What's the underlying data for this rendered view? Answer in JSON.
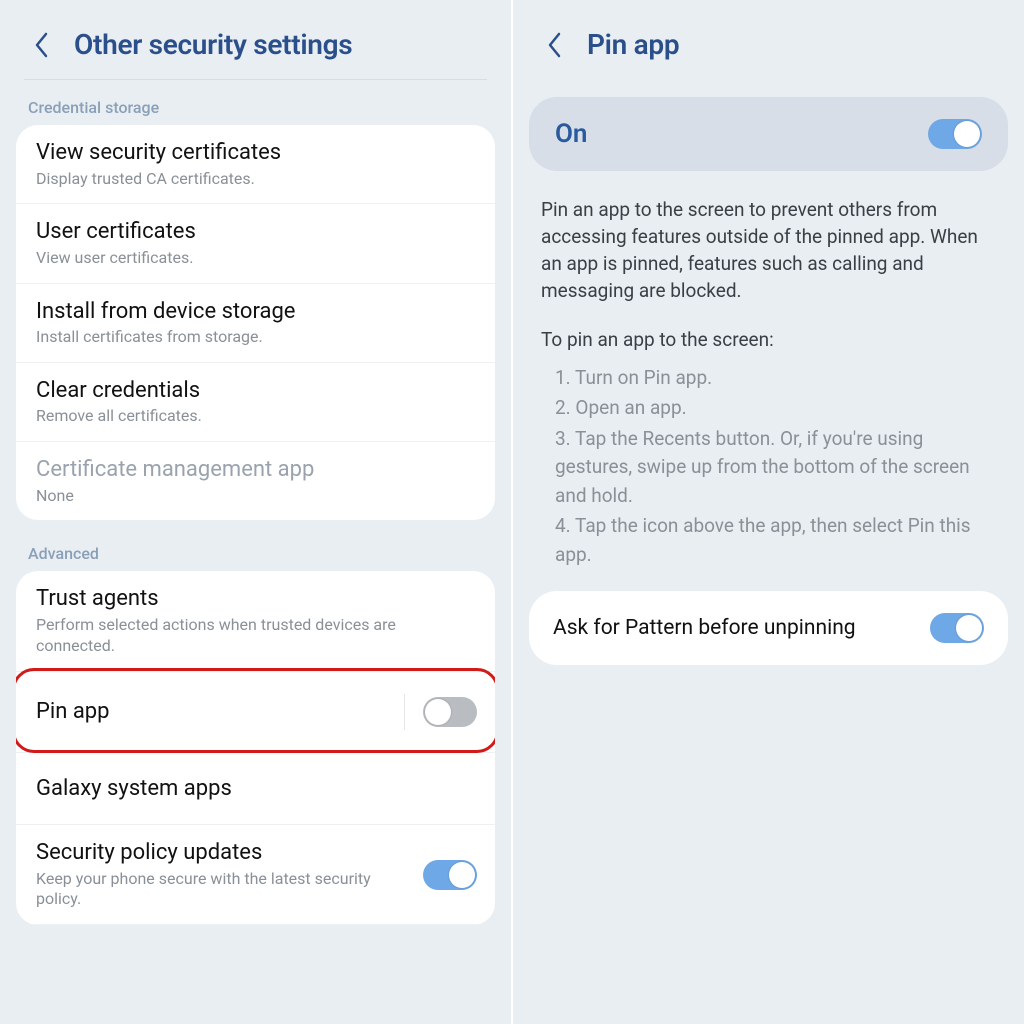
{
  "left": {
    "title": "Other security settings",
    "sections": [
      {
        "label": "Credential storage",
        "items": [
          {
            "title": "View security certificates",
            "sub": "Display trusted CA certificates."
          },
          {
            "title": "User certificates",
            "sub": "View user certificates."
          },
          {
            "title": "Install from device storage",
            "sub": "Install certificates from storage."
          },
          {
            "title": "Clear credentials",
            "sub": "Remove all certificates."
          },
          {
            "title": "Certificate management app",
            "sub": "None",
            "disabled": true
          }
        ]
      },
      {
        "label": "Advanced",
        "items": [
          {
            "title": "Trust agents",
            "sub": "Perform selected actions when trusted devices are connected."
          },
          {
            "title": "Pin app",
            "toggle": "off",
            "highlighted": true
          },
          {
            "title": "Galaxy system apps"
          },
          {
            "title": "Security policy updates",
            "sub": "Keep your phone secure with the latest security policy.",
            "toggle": "on"
          }
        ]
      }
    ]
  },
  "right": {
    "title": "Pin app",
    "on_label": "On",
    "on_toggle": "on",
    "description": "Pin an app to the screen to prevent others from accessing features outside of the pinned app. When an app is pinned, features such as calling and messaging are blocked.",
    "steps_title": "To pin an app to the screen:",
    "steps": [
      "1. Turn on Pin app.",
      "2. Open an app.",
      "3. Tap the Recents button. Or, if you're using gestures, swipe up from the bottom of the screen and hold.",
      "4. Tap the icon above the app, then select Pin this app."
    ],
    "ask_pattern": "Ask for Pattern before unpinning",
    "ask_pattern_toggle": "on"
  }
}
